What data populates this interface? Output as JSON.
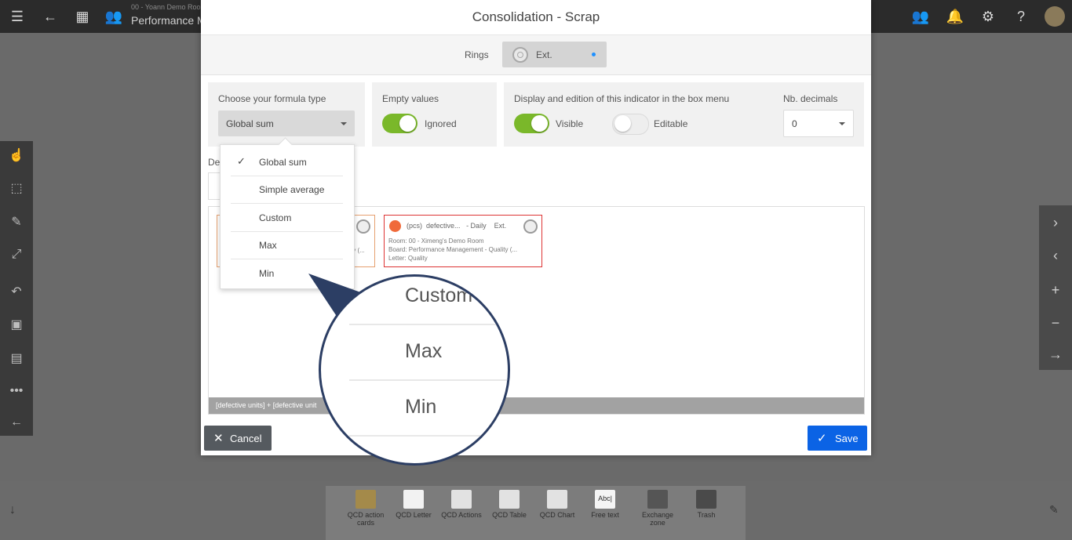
{
  "topbar": {
    "subtitle": "00 - Yoann Demo Roo",
    "title": "Performance M",
    "menu_icon": "hamburger-icon",
    "notification_count": "0"
  },
  "modal": {
    "title": "Consolidation - Scrap",
    "rings_label": "Rings",
    "rings_value": "Ext.",
    "formula_type_label": "Choose your formula type",
    "formula_type_value": "Global sum",
    "empty_values_label": "Empty values",
    "empty_values_toggle": "Ignored",
    "display_label": "Display and edition of this indicator in the box menu",
    "visible_label": "Visible",
    "editable_label": "Editable",
    "decimals_label": "Nb. decimals",
    "decimals_value": "0",
    "default_label_partial": "Def",
    "cancel_label": "Cancel",
    "save_label": "Save"
  },
  "formula_options": {
    "items": [
      {
        "label": "Global sum",
        "selected": true
      },
      {
        "label": "Simple average",
        "selected": false
      },
      {
        "label": "Custom",
        "selected": false
      },
      {
        "label": "Max",
        "selected": false
      },
      {
        "label": "Min",
        "selected": false
      }
    ]
  },
  "magnifier": {
    "items": [
      "Custom",
      "Max",
      "Min"
    ]
  },
  "cards": [
    {
      "ext": "Ext.",
      "room": "",
      "board_partial": "ty (..."
    },
    {
      "unit": "(pcs)",
      "name": "defective...",
      "frequency": "- Daily",
      "ext": "Ext.",
      "room": "Room: 00 - Ximeng's Demo Room",
      "board": "Board: Performance Management - Quality (...",
      "letter": "Letter: Quality"
    }
  ],
  "formula_bar": "[defective units] + [defective unit",
  "palette": {
    "items": [
      {
        "label": "QCD action cards"
      },
      {
        "label": "QCD Letter"
      },
      {
        "label": "QCD Actions"
      },
      {
        "label": "QCD Table"
      },
      {
        "label": "QCD Chart"
      },
      {
        "label": "Free text"
      },
      {
        "label": "Exchange zone"
      },
      {
        "label": "Trash"
      }
    ],
    "free_text_icon": "Abc|"
  },
  "colors": {
    "accent_green": "#7ab82a",
    "save_blue": "#0b63e5",
    "card_border_red": "#dd3333",
    "magnifier_border": "#2c3e64"
  }
}
